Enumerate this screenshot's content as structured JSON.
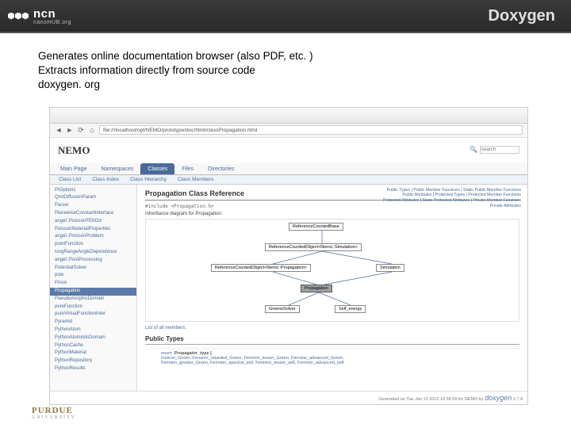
{
  "header": {
    "brand": "ncn",
    "brand_sub": "nanoHUB.org",
    "title": "Doxygen"
  },
  "bullets": {
    "l1": "Generates online documentation browser (also PDF, etc. )",
    "l2": "Extracts information directly from source code",
    "l3": "doxygen. org"
  },
  "browser": {
    "url": "file:///localhost/opt/NEMO/prototype/doc/html/classPropagation.html",
    "back": "◄",
    "fwd": "►",
    "reload": "⟳",
    "home": "⌂"
  },
  "doc": {
    "project": "NEMO",
    "search_lbl": "Search",
    "tabs": [
      "Main Page",
      "Namespaces",
      "Classes",
      "Files",
      "Directories"
    ],
    "active_tab": 2,
    "subtabs": [
      "Class List",
      "Class Index",
      "Class Hierarchy",
      "Class Members"
    ],
    "sidebar": [
      "PIOptions",
      "QmtDiffusionParam",
      "Parser",
      "PiecewiseConstantInterface",
      "angel::PoissonFEM2d",
      "PoissonMaterialProperties",
      "angel::PoissonProblem",
      "pointFunction",
      "longRangeAngleDependence",
      "angel::PostProcessing",
      "PotentialSolver",
      "pow",
      "Prism",
      "Propagation",
      "PseudomorphicDomain",
      "pureFunction",
      "pureVirtualFunctionInter",
      "Pyramid",
      "PythonAtom",
      "PythonAtomisticDomain",
      "PythonCache",
      "PythonMaterial",
      "PythonRepository",
      "PythonResults"
    ],
    "sidebar_active": 13,
    "summary": "Public Types | Public Member Functions | Static Public Member Functions\nPublic Attributes | Protected Types | Protected Member Functions\nProtected Attributes | Static Protected Attributes | Private Member Functions\nPrivate Attributes",
    "class_title": "Propagation Class Reference",
    "include": "#include <Propagation.h>",
    "inh_caption": "Inheritance diagram for Propagation:",
    "nodes": {
      "a": "ReferenceCountedBase",
      "b": "ReferenceCountedObject<Nemo::Simulation>",
      "c": "ReferenceCountedObject<Nemo::Propagation>",
      "d": "Simulation",
      "e": "Propagation",
      "f": "GreensSolver",
      "g": "Self_energy"
    },
    "members": "List of all members.",
    "sec_public_types": "Public Types",
    "enum_label": "enum",
    "enum_name": "Propagator_type {",
    "enum_vals": "Inverse_Green, Fermion_retarded_Green, Fermion_lesser_Green, Fermion_advanced_Green,\nFermion_greater_Green, Fermion_spectral_self, Fermion_lesser_self, Fermion_advanced_self",
    "footer": "Generated on Tue Jan 10 2012 10:58:59 for NEMO by",
    "dox": "doxygen",
    "ver": "1.7.4"
  },
  "purdue": {
    "a": "PURDUE",
    "b": "UNIVERSITY"
  }
}
